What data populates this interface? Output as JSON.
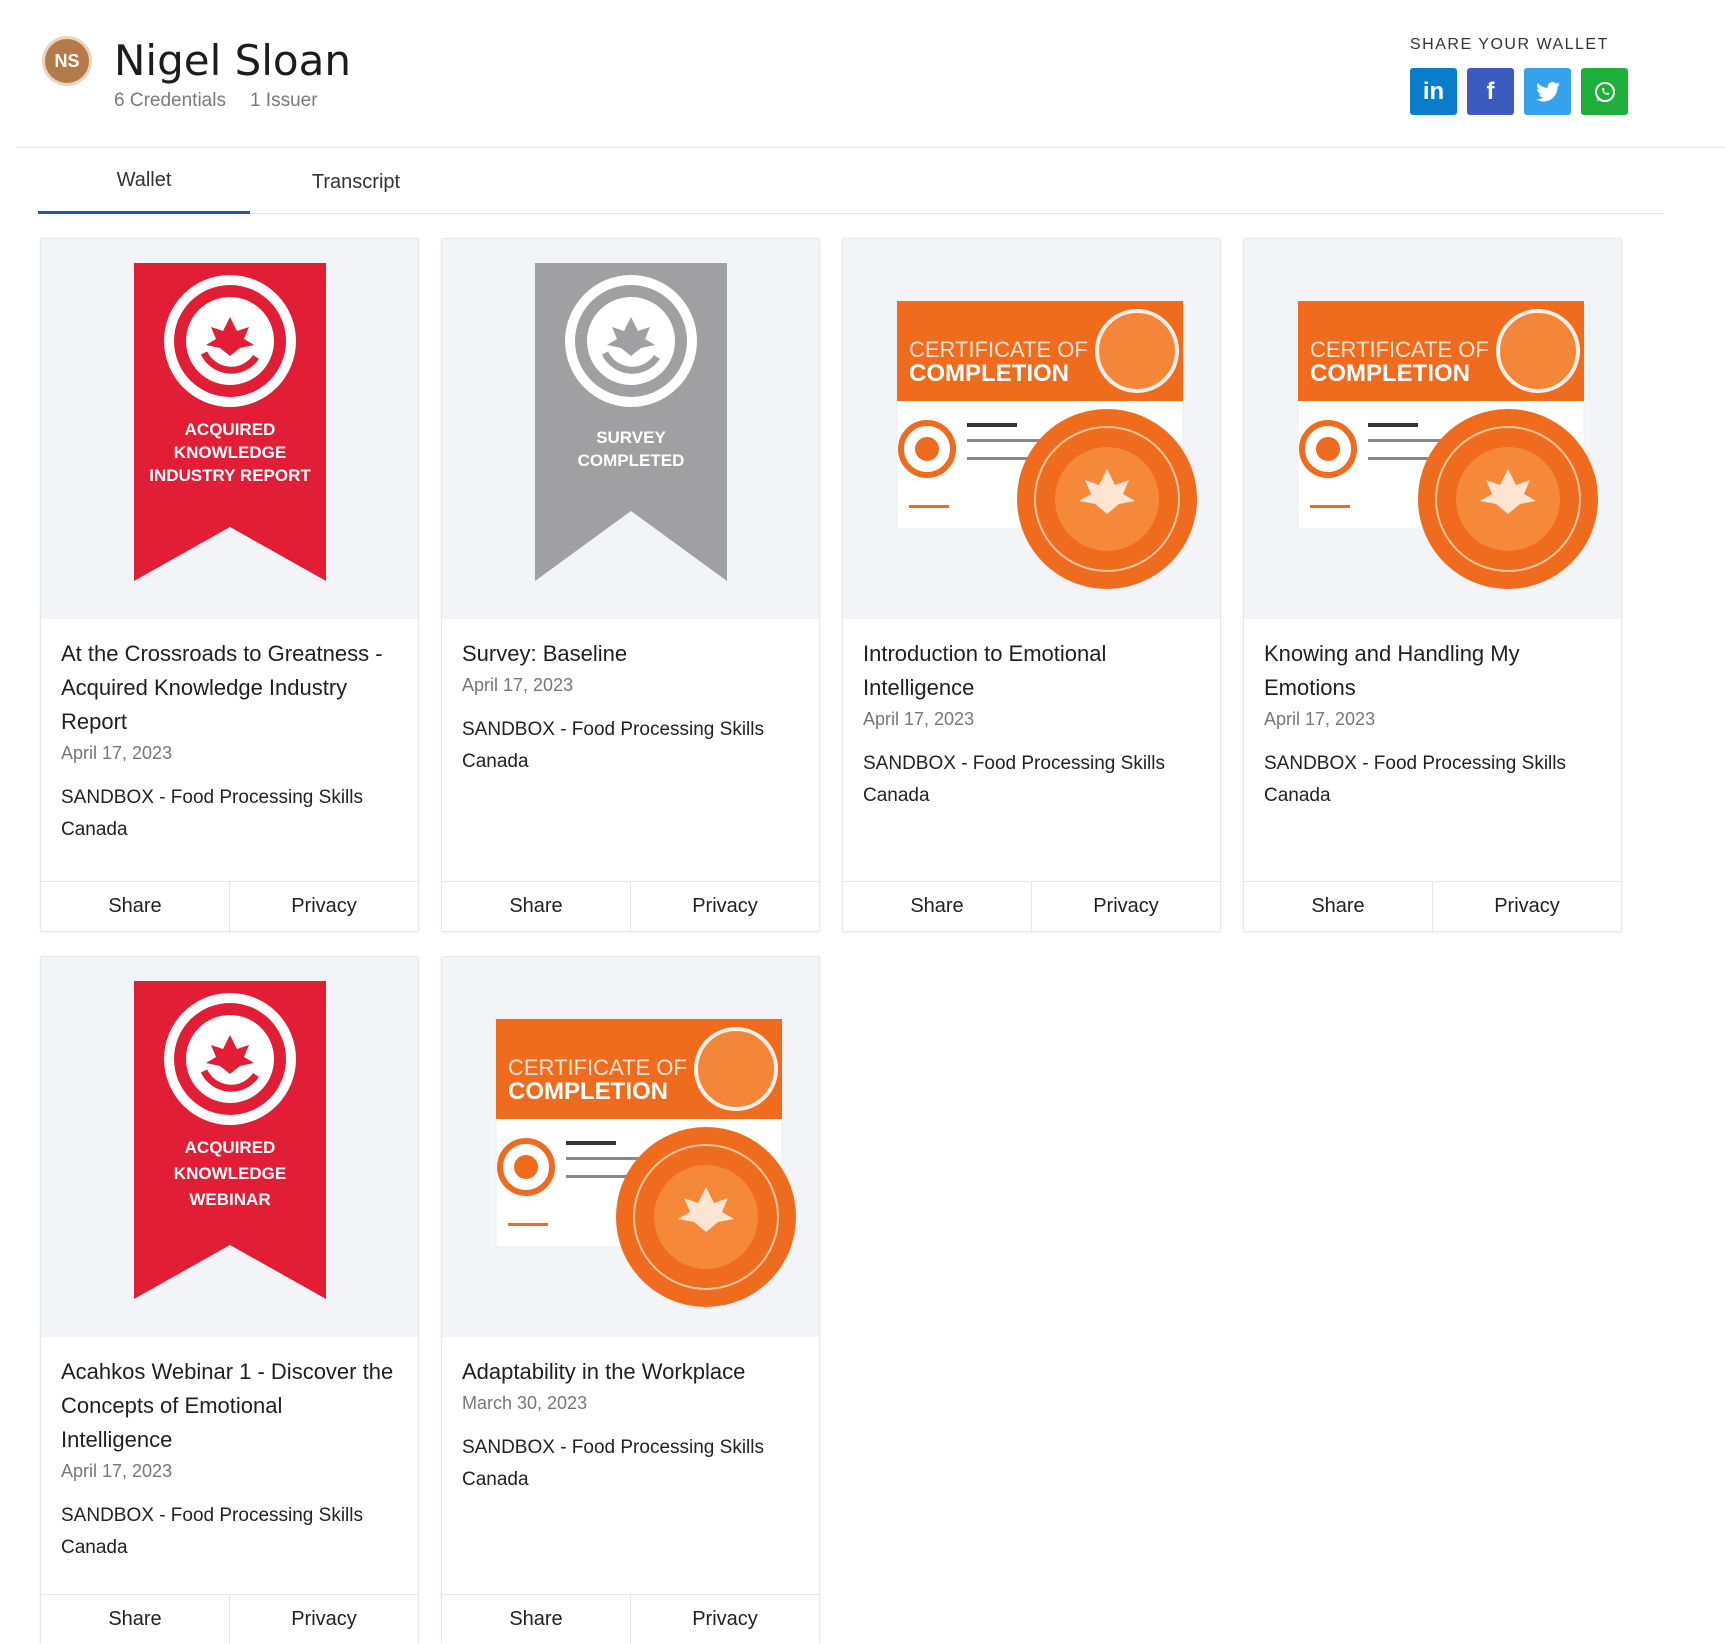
{
  "user": {
    "initials": "NS",
    "name": "Nigel Sloan",
    "credentials": "6 Credentials",
    "issuers": "1 Issuer"
  },
  "share": {
    "title": "SHARE YOUR WALLET",
    "buttons": [
      {
        "label": "in",
        "icon": "linkedin-icon",
        "color": "#0a7cc9"
      },
      {
        "label": "f",
        "icon": "facebook-icon",
        "color": "#3b5bbf"
      },
      {
        "label": "t",
        "icon": "twitter-icon",
        "color": "#35a2ec"
      },
      {
        "label": "w",
        "icon": "whatsapp-icon",
        "color": "#1faf3b"
      }
    ]
  },
  "tabs": [
    {
      "label": "Wallet",
      "active": true
    },
    {
      "label": "Transcript",
      "active": false
    }
  ],
  "colors": {
    "ribbon_red": "#e21d36",
    "ribbon_gray": "#a09fa1",
    "certificate_orange": "#ef6b1e",
    "tab_underline": "#3a4aa8"
  },
  "cards": [
    {
      "type": "ribbon",
      "ribbon_color": "#e21d36",
      "badge_text": [
        "ACQUIRED",
        "KNOWLEDGE",
        "INDUSTRY REPORT"
      ],
      "title": "At the Crossroads to Greatness - Acquired Knowledge Industry Report",
      "date": "April 17, 2023",
      "issuer": "SANDBOX - Food Processing Skills Canada",
      "share": "Share",
      "privacy": "Privacy"
    },
    {
      "type": "ribbon",
      "ribbon_color": "#a09fa1",
      "badge_text": [
        "SURVEY",
        "COMPLETED"
      ],
      "title": "Survey: Baseline",
      "date": "April 17, 2023",
      "issuer": "SANDBOX - Food Processing Skills Canada",
      "share": "Share",
      "privacy": "Privacy"
    },
    {
      "type": "certificate",
      "badge_text": [
        "CERTIFICATE OF",
        "COMPLETION"
      ],
      "title": "Introduction to Emotional Intelligence",
      "date": "April 17, 2023",
      "issuer": "SANDBOX - Food Processing Skills Canada",
      "share": "Share",
      "privacy": "Privacy"
    },
    {
      "type": "certificate",
      "badge_text": [
        "CERTIFICATE OF",
        "COMPLETION"
      ],
      "title": "Knowing and Handling My Emotions",
      "date": "April 17, 2023",
      "issuer": "SANDBOX - Food Processing Skills Canada",
      "share": "Share",
      "privacy": "Privacy"
    },
    {
      "type": "ribbon",
      "ribbon_color": "#e21d36",
      "badge_text": [
        "ACQUIRED",
        "KNOWLEDGE",
        "WEBINAR"
      ],
      "title": "Acahkos Webinar 1 - Discover the Concepts of Emotional Intelligence",
      "date": "April 17, 2023",
      "issuer": "SANDBOX - Food Processing Skills Canada",
      "share": "Share",
      "privacy": "Privacy"
    },
    {
      "type": "certificate",
      "badge_text": [
        "CERTIFICATE OF",
        "COMPLETION"
      ],
      "title": "Adaptability in the Workplace",
      "date": "March 30, 2023",
      "issuer": "SANDBOX - Food Processing Skills Canada",
      "share": "Share",
      "privacy": "Privacy"
    }
  ]
}
